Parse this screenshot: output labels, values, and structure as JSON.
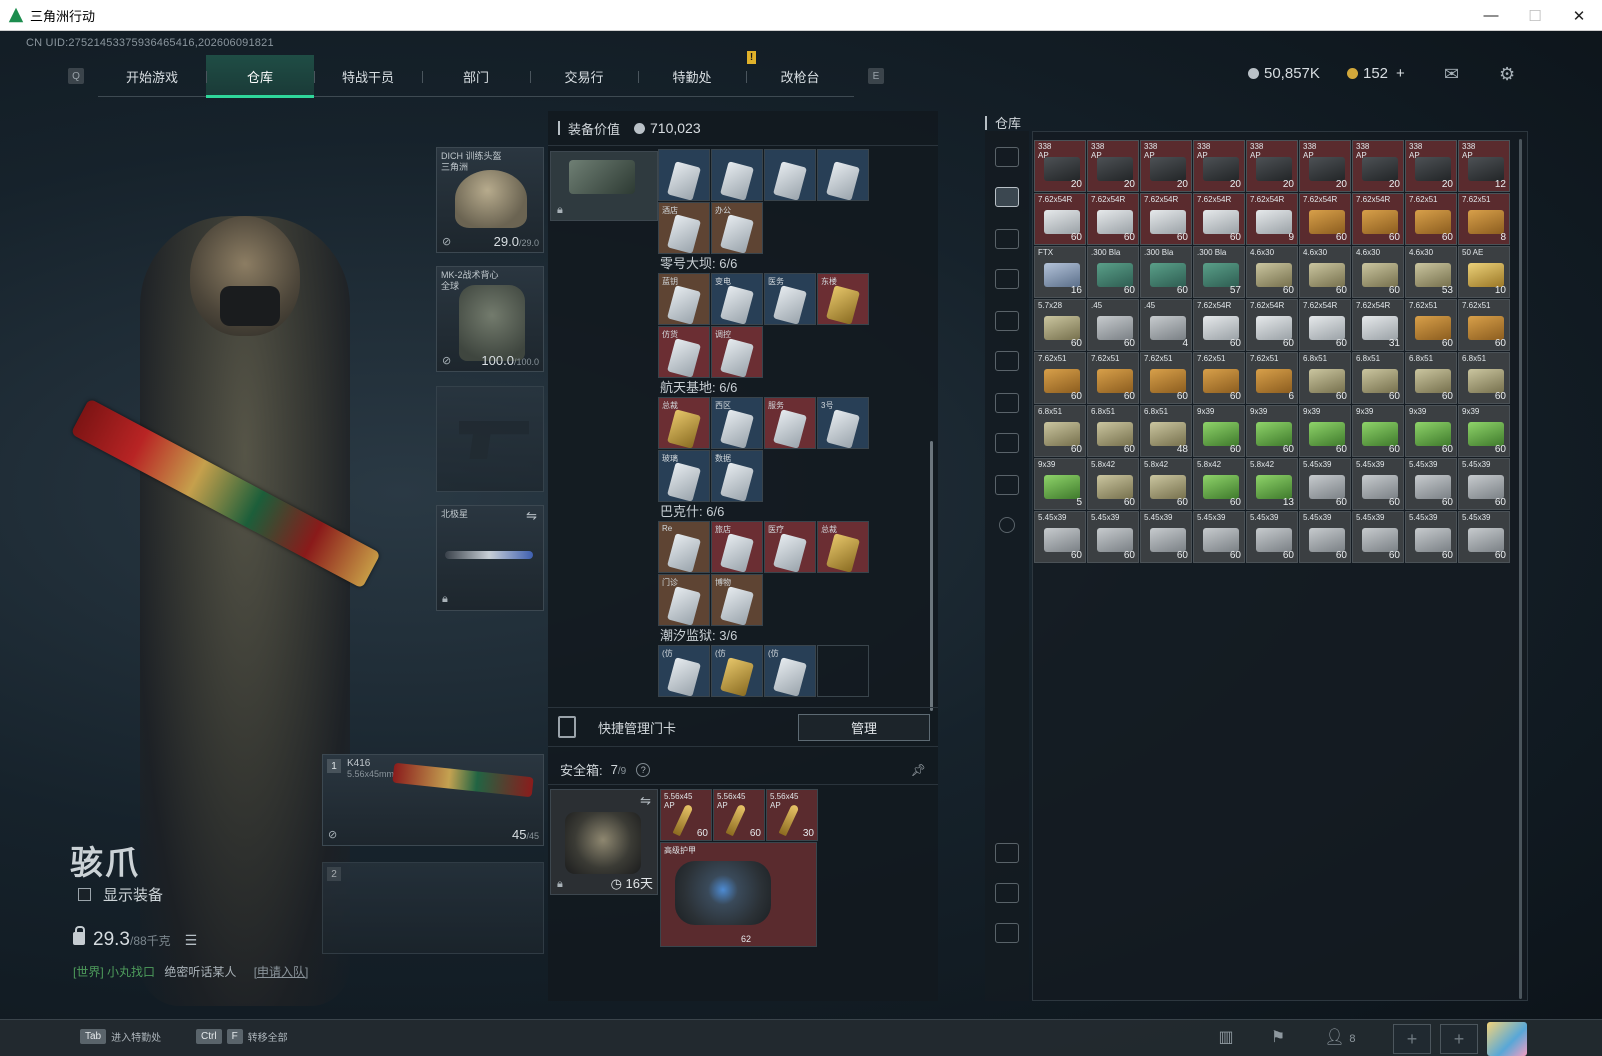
{
  "window": {
    "title": "三角洲行动",
    "controls": [
      "—",
      "☐",
      "✕"
    ]
  },
  "uid_text": "CN UID:2752145337593646541​6,202606091821",
  "nav": {
    "left_key": "Q",
    "right_key": "E",
    "tabs": [
      "开始游戏",
      "仓库",
      "特战干员",
      "部门",
      "交易行",
      "特勤处",
      "改枪台"
    ],
    "active_tab": "仓库",
    "notif": "!"
  },
  "currency": {
    "silver": "50,857K",
    "gold": "152",
    "gold_add": "+"
  },
  "character": {
    "name": "骇爪",
    "show_equip_label": "显示装备",
    "weight": "29.3",
    "weight_max": "/88千克",
    "chat_channel": "[世界] 小丸找口",
    "chat_msg": "绝密听话某人",
    "chat_apply": "[申请入队]"
  },
  "slots": {
    "helmet": {
      "label": "DICH 训练头盔\n三角洲",
      "dur": "29.0",
      "dur_max": "/29.0"
    },
    "vest": {
      "label": "MK-2战术背心\n全球",
      "dur": "100.0",
      "dur_max": "/100.0"
    },
    "melee": {
      "label": "北极星"
    },
    "primary": {
      "num": "1",
      "name": "K416",
      "ammo": "5.56x45mm",
      "count": "45",
      "count_max": "/45"
    },
    "secondary": {
      "num": "2"
    }
  },
  "equip_panel": {
    "title": "装备价值",
    "value": "710,023",
    "groups": [
      {
        "title": "",
        "cards": [
          {
            "n": "",
            "c": "blue"
          },
          {
            "n": "",
            "c": "blue"
          },
          {
            "n": "",
            "c": "blue"
          },
          {
            "n": "",
            "c": "blue"
          },
          {
            "n": "酒店",
            "c": "brown"
          },
          {
            "n": "办公",
            "c": "brown"
          }
        ]
      },
      {
        "title": "零号大坝: 6/6",
        "cards": [
          {
            "n": "蓝钥",
            "c": "brown"
          },
          {
            "n": "变电",
            "c": "blue"
          },
          {
            "n": "医务",
            "c": "blue"
          },
          {
            "n": "东楼",
            "c": "red",
            "gold": true
          },
          {
            "n": "仿货",
            "c": "red"
          },
          {
            "n": "调控",
            "c": "red"
          }
        ]
      },
      {
        "title": "航天基地: 6/6",
        "cards": [
          {
            "n": "总裁",
            "c": "red",
            "gold": true
          },
          {
            "n": "西区",
            "c": "blue"
          },
          {
            "n": "服务",
            "c": "red"
          },
          {
            "n": "3号",
            "c": "blue"
          },
          {
            "n": "玻璃",
            "c": "blue"
          },
          {
            "n": "数据",
            "c": "blue"
          }
        ]
      },
      {
        "title": "巴克什: 6/6",
        "cards": [
          {
            "n": "Re",
            "c": "brown"
          },
          {
            "n": "旅店",
            "c": "red"
          },
          {
            "n": "医疗",
            "c": "red"
          },
          {
            "n": "总裁",
            "c": "red",
            "gold": true
          },
          {
            "n": "门诊",
            "c": "brown"
          },
          {
            "n": "博物",
            "c": "brown"
          }
        ]
      },
      {
        "title": "潮汐监狱: 3/6",
        "cards": [
          {
            "n": "(仿",
            "c": "blue"
          },
          {
            "n": "(仿",
            "c": "blue",
            "gold": true
          },
          {
            "n": "(仿",
            "c": "blue"
          },
          {
            "n": "",
            "c": "empty"
          }
        ]
      }
    ],
    "quick_label": "快捷管理门卡",
    "manage_btn": "管理",
    "safebox_title": "安全箱:",
    "safebox_cap": "7",
    "safebox_cap_max": "/9",
    "safebox_days": "16天",
    "safe_ammo": [
      {
        "n": "5.56x45\nAP",
        "c": "60"
      },
      {
        "n": "5.56x45\nAP",
        "c": "60"
      },
      {
        "n": "5.56x45\nAP",
        "c": "30"
      }
    ],
    "armor_name": "高级护甲",
    "armor_count": "62"
  },
  "warehouse": {
    "title": "仓库",
    "items": [
      {
        "n": "338\nAP",
        "c": "20",
        "b": "dark",
        "r": 1
      },
      {
        "n": "338\nAP",
        "c": "20",
        "b": "dark",
        "r": 1
      },
      {
        "n": "338\nAP",
        "c": "20",
        "b": "dark",
        "r": 1
      },
      {
        "n": "338\nAP",
        "c": "20",
        "b": "dark",
        "r": 1
      },
      {
        "n": "338\nAP",
        "c": "20",
        "b": "dark",
        "r": 1
      },
      {
        "n": "338\nAP",
        "c": "20",
        "b": "dark",
        "r": 1
      },
      {
        "n": "338\nAP",
        "c": "20",
        "b": "dark",
        "r": 1
      },
      {
        "n": "338\nAP",
        "c": "20",
        "b": "dark",
        "r": 1
      },
      {
        "n": "338\nAP",
        "c": "12",
        "b": "dark",
        "r": 1
      },
      {
        "n": "7.62x54R",
        "c": "60",
        "b": "white",
        "r": 1
      },
      {
        "n": "7.62x54R",
        "c": "60",
        "b": "white",
        "r": 1
      },
      {
        "n": "7.62x54R",
        "c": "60",
        "b": "white",
        "r": 1
      },
      {
        "n": "7.62x54R",
        "c": "60",
        "b": "white",
        "r": 1
      },
      {
        "n": "7.62x54R",
        "c": "9",
        "b": "white",
        "r": 1
      },
      {
        "n": "7.62x54R",
        "c": "60",
        "b": "tan",
        "r": 1
      },
      {
        "n": "7.62x54R",
        "c": "60",
        "b": "tan",
        "r": 1
      },
      {
        "n": "7.62x51",
        "c": "60",
        "b": "tan",
        "r": 1
      },
      {
        "n": "7.62x51",
        "c": "8",
        "b": "tan",
        "r": 1
      },
      {
        "n": "FTX",
        "c": "16",
        "b": "blue",
        "r": 0
      },
      {
        "n": ".300 Bla",
        "c": "60",
        "b": "teal",
        "r": 0
      },
      {
        "n": ".300 Bla",
        "c": "60",
        "b": "teal",
        "r": 0
      },
      {
        "n": ".300 Bla",
        "c": "57",
        "b": "teal",
        "r": 0
      },
      {
        "n": "4.6x30",
        "c": "60",
        "b": "olive",
        "r": 0
      },
      {
        "n": "4.6x30",
        "c": "60",
        "b": "olive",
        "r": 0
      },
      {
        "n": "4.6x30",
        "c": "60",
        "b": "olive",
        "r": 0
      },
      {
        "n": "4.6x30",
        "c": "53",
        "b": "olive",
        "r": 0
      },
      {
        "n": "50 AE",
        "c": "10",
        "b": "gold",
        "r": 0
      },
      {
        "n": "5.7x28",
        "c": "60",
        "b": "olive",
        "r": 0
      },
      {
        "n": ".45",
        "c": "60",
        "b": "grey",
        "r": 0
      },
      {
        "n": ".45",
        "c": "4",
        "b": "grey",
        "r": 0
      },
      {
        "n": "7.62x54R",
        "c": "60",
        "b": "white",
        "r": 0
      },
      {
        "n": "7.62x54R",
        "c": "60",
        "b": "white",
        "r": 0
      },
      {
        "n": "7.62x54R",
        "c": "60",
        "b": "white",
        "r": 0
      },
      {
        "n": "7.62x54R",
        "c": "31",
        "b": "white",
        "r": 0
      },
      {
        "n": "7.62x51",
        "c": "60",
        "b": "tan",
        "r": 0
      },
      {
        "n": "7.62x51",
        "c": "60",
        "b": "tan",
        "r": 0
      },
      {
        "n": "7.62x51",
        "c": "60",
        "b": "tan",
        "r": 0
      },
      {
        "n": "7.62x51",
        "c": "60",
        "b": "tan",
        "r": 0
      },
      {
        "n": "7.62x51",
        "c": "60",
        "b": "tan",
        "r": 0
      },
      {
        "n": "7.62x51",
        "c": "60",
        "b": "tan",
        "r": 0
      },
      {
        "n": "7.62x51",
        "c": "6",
        "b": "tan",
        "r": 0
      },
      {
        "n": "6.8x51",
        "c": "60",
        "b": "olive",
        "r": 0
      },
      {
        "n": "6.8x51",
        "c": "60",
        "b": "olive",
        "r": 0
      },
      {
        "n": "6.8x51",
        "c": "60",
        "b": "olive",
        "r": 0
      },
      {
        "n": "6.8x51",
        "c": "60",
        "b": "olive",
        "r": 0
      },
      {
        "n": "6.8x51",
        "c": "60",
        "b": "olive",
        "r": 0
      },
      {
        "n": "6.8x51",
        "c": "60",
        "b": "olive",
        "r": 0
      },
      {
        "n": "6.8x51",
        "c": "48",
        "b": "olive",
        "r": 0
      },
      {
        "n": "9x39",
        "c": "60",
        "b": "green",
        "r": 0
      },
      {
        "n": "9x39",
        "c": "60",
        "b": "green",
        "r": 0
      },
      {
        "n": "9x39",
        "c": "60",
        "b": "green",
        "r": 0
      },
      {
        "n": "9x39",
        "c": "60",
        "b": "green",
        "r": 0
      },
      {
        "n": "9x39",
        "c": "60",
        "b": "green",
        "r": 0
      },
      {
        "n": "9x39",
        "c": "60",
        "b": "green",
        "r": 0
      },
      {
        "n": "9x39",
        "c": "5",
        "b": "green",
        "r": 0
      },
      {
        "n": "5.8x42",
        "c": "60",
        "b": "olive",
        "r": 0
      },
      {
        "n": "5.8x42",
        "c": "60",
        "b": "olive",
        "r": 0
      },
      {
        "n": "5.8x42",
        "c": "60",
        "b": "green",
        "r": 0
      },
      {
        "n": "5.8x42",
        "c": "13",
        "b": "green",
        "r": 0
      },
      {
        "n": "5.45x39",
        "c": "60",
        "b": "grey",
        "r": 0
      },
      {
        "n": "5.45x39",
        "c": "60",
        "b": "grey",
        "r": 0
      },
      {
        "n": "5.45x39",
        "c": "60",
        "b": "grey",
        "r": 0
      },
      {
        "n": "5.45x39",
        "c": "60",
        "b": "grey",
        "r": 0
      },
      {
        "n": "5.45x39",
        "c": "60",
        "b": "grey",
        "r": 0
      },
      {
        "n": "5.45x39",
        "c": "60",
        "b": "grey",
        "r": 0
      },
      {
        "n": "5.45x39",
        "c": "60",
        "b": "grey",
        "r": 0
      },
      {
        "n": "5.45x39",
        "c": "60",
        "b": "grey",
        "r": 0
      },
      {
        "n": "5.45x39",
        "c": "60",
        "b": "grey",
        "r": 0
      },
      {
        "n": "5.45x39",
        "c": "60",
        "b": "grey",
        "r": 0
      },
      {
        "n": "5.45x39",
        "c": "60",
        "b": "grey",
        "r": 0
      },
      {
        "n": "5.45x39",
        "c": "60",
        "b": "grey",
        "r": 0
      },
      {
        "n": "5.45x39",
        "c": "60",
        "b": "grey",
        "r": 0
      }
    ]
  },
  "bottombar": {
    "tab_key": "Tab",
    "tab_label": "进入特勤处",
    "ctrl_key": "Ctrl",
    "f_key": "F",
    "transfer_label": "转移全部",
    "friends": "8"
  },
  "colors": {
    "accent": "#2fd69a",
    "card_red": "#6b2e33",
    "card_blue": "#283f56",
    "card_brown": "#5e4433"
  }
}
